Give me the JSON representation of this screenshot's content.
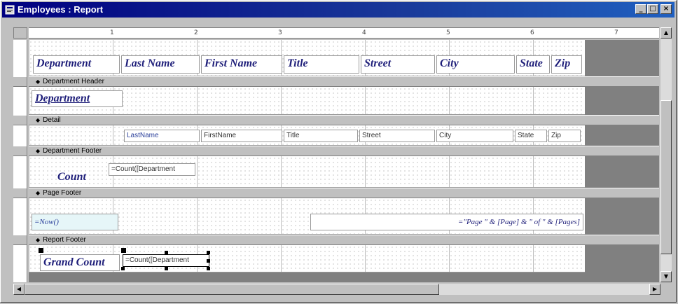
{
  "window": {
    "title": "Employees : Report",
    "minimize_label": "_",
    "maximize_label": "□",
    "close_label": "×"
  },
  "ruler": {
    "numbers": [
      "1",
      "2",
      "3",
      "4",
      "5",
      "6",
      "7"
    ]
  },
  "report_header": {
    "labels": [
      "Department",
      "Last Name",
      "First Name",
      "Title",
      "Street",
      "City",
      "State",
      "Zip"
    ]
  },
  "sections": {
    "department_header": "Department Header",
    "detail": "Detail",
    "department_footer": "Department Footer",
    "page_footer": "Page Footer",
    "report_footer": "Report Footer"
  },
  "department_header_band": {
    "label": "Department"
  },
  "detail_band": {
    "fields": [
      "LastName",
      "FirstName",
      "Title",
      "Street",
      "City",
      "State",
      "Zip"
    ]
  },
  "department_footer_band": {
    "label": "Count",
    "expression": "=Count([Department"
  },
  "page_footer_band": {
    "now_expr": "=Now()",
    "page_expr": "=\"Page \" & [Page] & \" of \" & [Pages]"
  },
  "report_footer_band": {
    "label": "Grand Count",
    "expression": "=Count([Department"
  },
  "colors": {
    "titlebar": "#000080",
    "label_text": "#1f1f7a",
    "field_text": "#2a3f9a"
  }
}
